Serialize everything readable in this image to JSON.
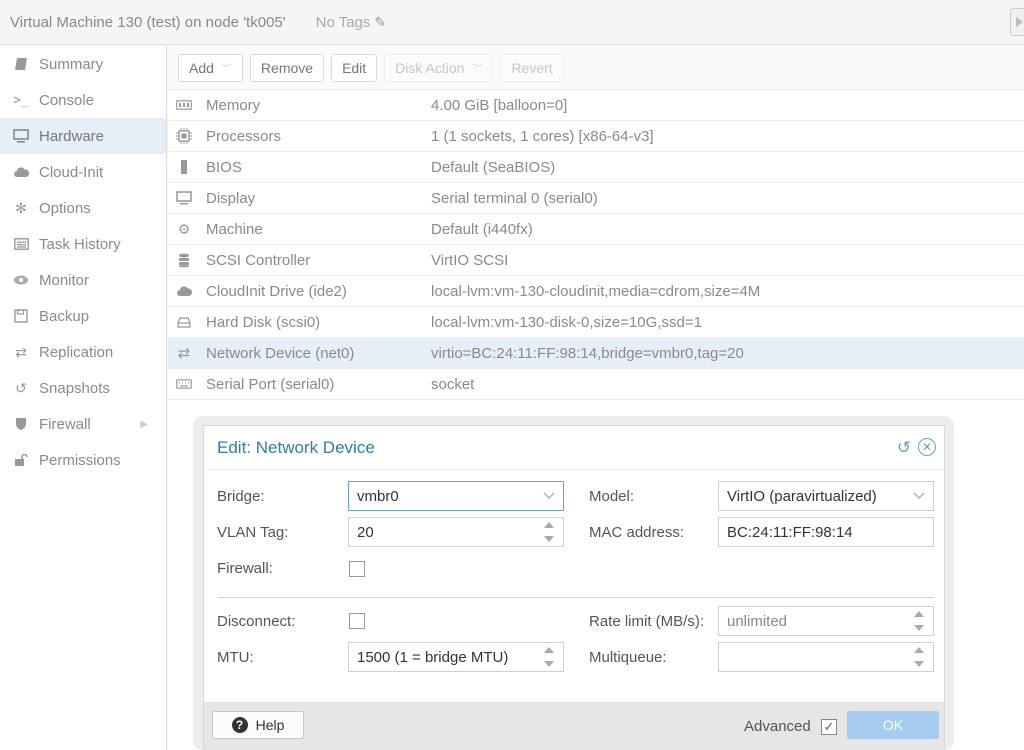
{
  "header": {
    "vm_title": "Virtual Machine 130 (test) on node 'tk005'",
    "tags_label": "No Tags"
  },
  "sidebar": {
    "items": [
      {
        "label": "Summary",
        "icon": "book-icon"
      },
      {
        "label": "Console",
        "icon": "terminal-icon"
      },
      {
        "label": "Hardware",
        "icon": "monitor-icon"
      },
      {
        "label": "Cloud-Init",
        "icon": "cloud-icon"
      },
      {
        "label": "Options",
        "icon": "gear-icon"
      },
      {
        "label": "Task History",
        "icon": "list-icon"
      },
      {
        "label": "Monitor",
        "icon": "eye-icon"
      },
      {
        "label": "Backup",
        "icon": "floppy-icon"
      },
      {
        "label": "Replication",
        "icon": "retweet-icon"
      },
      {
        "label": "Snapshots",
        "icon": "history-icon"
      },
      {
        "label": "Firewall",
        "icon": "shield-icon"
      },
      {
        "label": "Permissions",
        "icon": "unlock-icon"
      }
    ]
  },
  "toolbar": {
    "add": "Add",
    "remove": "Remove",
    "edit": "Edit",
    "disk_action": "Disk Action",
    "revert": "Revert"
  },
  "hardware": {
    "rows": [
      {
        "name": "Memory",
        "value": "4.00 GiB [balloon=0]"
      },
      {
        "name": "Processors",
        "value": "1 (1 sockets, 1 cores) [x86-64-v3]"
      },
      {
        "name": "BIOS",
        "value": "Default (SeaBIOS)"
      },
      {
        "name": "Display",
        "value": "Serial terminal 0 (serial0)"
      },
      {
        "name": "Machine",
        "value": "Default (i440fx)"
      },
      {
        "name": "SCSI Controller",
        "value": "VirtIO SCSI"
      },
      {
        "name": "CloudInit Drive (ide2)",
        "value": "local-lvm:vm-130-cloudinit,media=cdrom,size=4M"
      },
      {
        "name": "Hard Disk (scsi0)",
        "value": "local-lvm:vm-130-disk-0,size=10G,ssd=1"
      },
      {
        "name": "Network Device (net0)",
        "value": "virtio=BC:24:11:FF:98:14,bridge=vmbr0,tag=20"
      },
      {
        "name": "Serial Port (serial0)",
        "value": "socket"
      }
    ]
  },
  "dialog": {
    "title": "Edit: Network Device",
    "bridge_label": "Bridge:",
    "bridge_value": "vmbr0",
    "vlan_label": "VLAN Tag:",
    "vlan_value": "20",
    "firewall_label": "Firewall:",
    "model_label": "Model:",
    "model_value": "VirtIO (paravirtualized)",
    "mac_label": "MAC address:",
    "mac_value": "BC:24:11:FF:98:14",
    "disconnect_label": "Disconnect:",
    "mtu_label": "MTU:",
    "mtu_value": "1500 (1 = bridge MTU)",
    "rate_label": "Rate limit (MB/s):",
    "rate_placeholder": "unlimited",
    "multiqueue_label": "Multiqueue:",
    "multiqueue_value": "",
    "help_label": "Help",
    "advanced_label": "Advanced",
    "ok_label": "OK"
  },
  "colors": {
    "accent": "#2f7ab9",
    "selected_row": "#e6eef7",
    "ok_button": "#a5cdef"
  }
}
